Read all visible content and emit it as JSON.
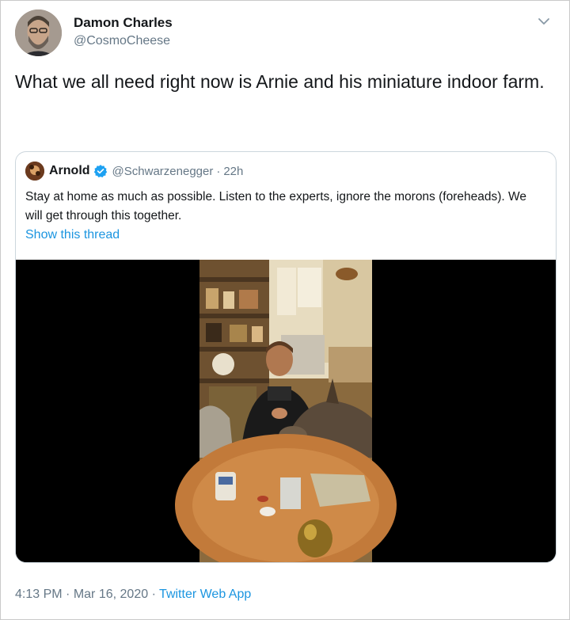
{
  "tweet": {
    "display_name": "Damon Charles",
    "handle": "@CosmoCheese",
    "text": "What we all need right now is Arnie and his miniature indoor farm.",
    "menu_icon": "chevron-down-icon"
  },
  "quoted_tweet": {
    "display_name": "Arnold",
    "verified_icon": "verified-badge-icon",
    "handle": "@Schwarzenegger",
    "separator": "·",
    "time": "22h",
    "text": "Stay at home as much as possible. Listen to the experts, ignore the morons (foreheads). We will get through this together.",
    "show_thread_label": "Show this thread",
    "media": "video-thumbnail"
  },
  "footer": {
    "time": "4:13 PM",
    "separator": "·",
    "date": "Mar 16, 2020",
    "app": "Twitter Web App"
  },
  "colors": {
    "link_blue": "#1b95e0",
    "secondary_text": "#657786",
    "border": "#ccd6dd"
  }
}
